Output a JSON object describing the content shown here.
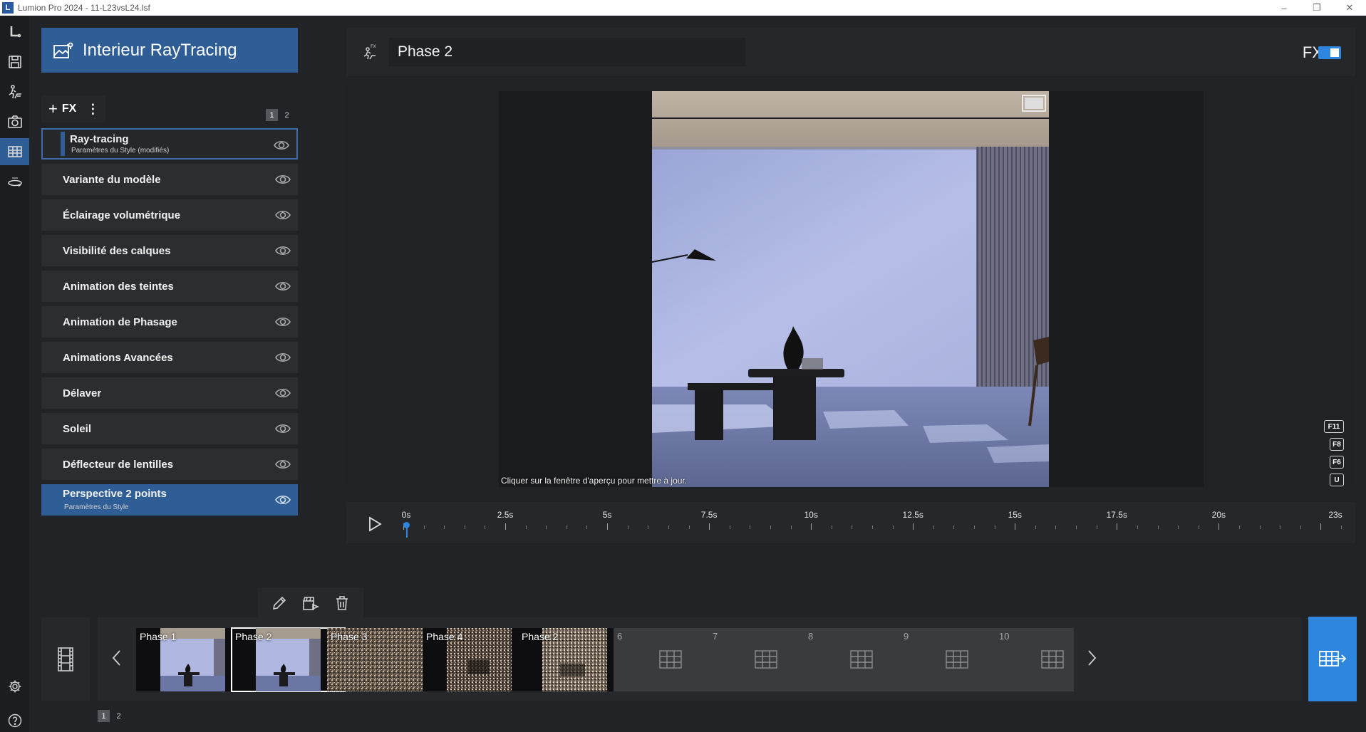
{
  "window": {
    "title": "Lumion Pro 2024 - 11-L23vsL24.lsf",
    "logo_letter": "L",
    "minimize": "–",
    "maximize": "❐",
    "close": "✕"
  },
  "rail": {
    "items": [
      "logo-icon",
      "save-icon",
      "build-icon",
      "photo-icon",
      "movie-icon",
      "panorama-icon"
    ],
    "active": "movie-icon",
    "bottom": [
      "settings-icon",
      "help-icon"
    ]
  },
  "project": {
    "title": "Interieur RayTracing"
  },
  "fx_panel": {
    "add_label": "FX",
    "add_symbol": "+",
    "menu_symbol": "⋮",
    "pages": [
      "1",
      "2"
    ],
    "active_page": "1",
    "effects": [
      {
        "label": "Ray-tracing",
        "sub": "Paramètres du Style (modifiés)",
        "state": "selected"
      },
      {
        "label": "Variante du modèle",
        "sub": "",
        "state": "normal"
      },
      {
        "label": "Éclairage volumétrique",
        "sub": "",
        "state": "normal"
      },
      {
        "label": "Visibilité des calques",
        "sub": "",
        "state": "normal"
      },
      {
        "label": "Animation des teintes",
        "sub": "",
        "state": "normal"
      },
      {
        "label": "Animation de Phasage",
        "sub": "",
        "state": "normal"
      },
      {
        "label": "Animations Avancées",
        "sub": "",
        "state": "normal"
      },
      {
        "label": "Délaver",
        "sub": "",
        "state": "normal"
      },
      {
        "label": "Soleil",
        "sub": "",
        "state": "normal"
      },
      {
        "label": "Déflecteur de lentilles",
        "sub": "",
        "state": "normal"
      },
      {
        "label": "Perspective 2 points",
        "sub": "Paramètres du Style",
        "state": "highlight"
      }
    ]
  },
  "header": {
    "phase_name": "Phase 2",
    "fx_label": "FX",
    "fx_enabled": true,
    "toggle_color": "#2e86de"
  },
  "viewport": {
    "hint": "Cliquer sur la fenêtre d'aperçu pour mettre à jour.",
    "shortcut_keys": [
      "F11",
      "F8",
      "F6",
      "U"
    ]
  },
  "timeline": {
    "labels": [
      "0s",
      "2.5s",
      "5s",
      "7.5s",
      "10s",
      "12.5s",
      "15s",
      "17.5s",
      "20s",
      "23s"
    ],
    "duration_s": 23,
    "playhead_s": 0
  },
  "clip_tools": [
    "edit-icon",
    "render-clip-icon",
    "delete-clip-icon"
  ],
  "filmstrip": {
    "clips": [
      {
        "name": "Phase 1",
        "type": "clean",
        "selected": false
      },
      {
        "name": "Phase 2",
        "type": "clean",
        "selected": true
      },
      {
        "name": "Phase 3",
        "type": "noisy-wide",
        "selected": false
      },
      {
        "name": "Phase 4",
        "type": "noisy",
        "selected": false
      },
      {
        "name": "Phase 2",
        "type": "noisy",
        "selected": false
      },
      {
        "name": "6",
        "type": "empty",
        "selected": false
      },
      {
        "name": "7",
        "type": "empty",
        "selected": false
      },
      {
        "name": "8",
        "type": "empty",
        "selected": false
      },
      {
        "name": "9",
        "type": "empty",
        "selected": false
      },
      {
        "name": "10",
        "type": "empty",
        "selected": false
      }
    ],
    "pages": [
      "1",
      "2"
    ],
    "active_page": "1",
    "accent": "#2e86de"
  }
}
